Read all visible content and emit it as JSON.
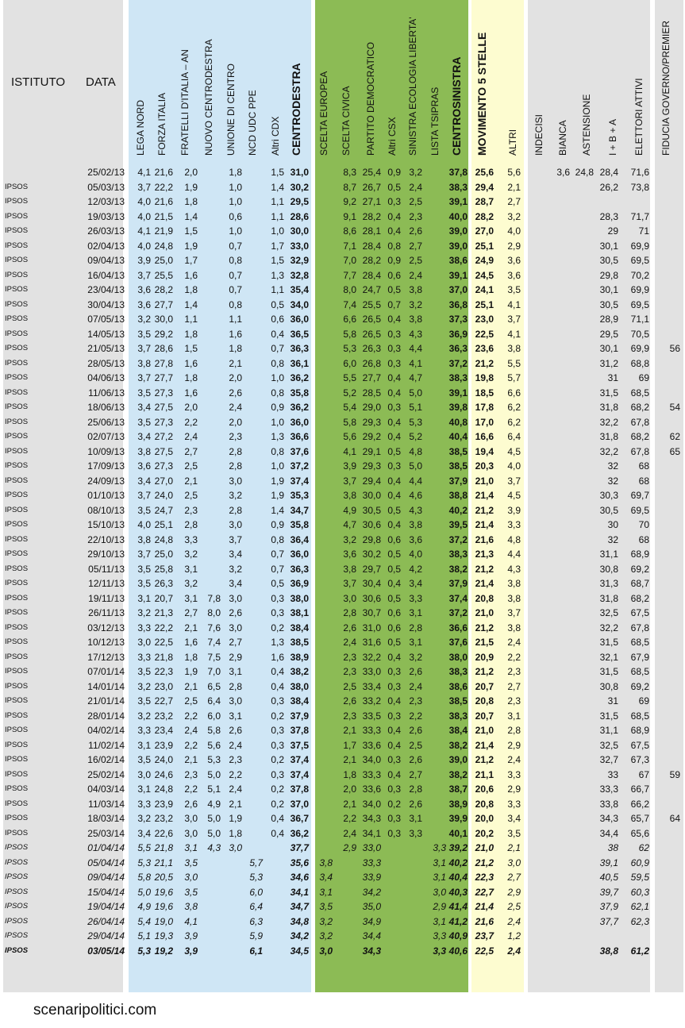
{
  "colors": {
    "grey": "#e2e2e2",
    "blue": "#cfe6f5",
    "green": "#8cbb55",
    "yellow": "#fdfcd0"
  },
  "headers": {
    "istituto": "ISTITUTO",
    "data": "DATA",
    "cols": [
      "LEGA NORD",
      "FORZA ITALIA",
      "FRATELLI D'ITALIA – AN",
      "NUOVO CENTRODESTRA",
      "UNIONE DI CENTRO",
      "NCD UDC PPE",
      "Altri CDX",
      "CENTRODESTRA",
      "SCELTA EUROPEA",
      "SCELTA CIVICA",
      "PARTITO DEMOCRATICO",
      "Altri CSX",
      "SINISTRA ECOLOGIA LIBERTA'",
      "LISTA TSIPRAS",
      "CENTROSINISTRA",
      "MOVIMENTO 5 STELLE",
      "ALTRI",
      "INDECISI",
      "BIANCA",
      "ASTENSIONE",
      "I + B + A",
      "ELETTORI ATTIVI",
      "FIDUCIA GOVERNO/PREMIER"
    ]
  },
  "rows": [
    [
      "",
      "25/02/13",
      "4,1",
      "21,6",
      "2,0",
      "",
      "1,8",
      "",
      "1,5",
      "31,0",
      "",
      "8,3",
      "25,4",
      "0,9",
      "3,2",
      "",
      "37,8",
      "25,6",
      "5,6",
      "",
      "3,6",
      "24,8",
      "28,4",
      "71,6",
      ""
    ],
    [
      "IPSOS",
      "05/03/13",
      "3,7",
      "22,2",
      "1,9",
      "",
      "1,0",
      "",
      "1,4",
      "30,2",
      "",
      "8,7",
      "26,7",
      "0,5",
      "2,4",
      "",
      "38,3",
      "29,4",
      "2,1",
      "",
      "",
      "",
      "26,2",
      "73,8",
      ""
    ],
    [
      "IPSOS",
      "12/03/13",
      "4,0",
      "21,6",
      "1,8",
      "",
      "1,0",
      "",
      "1,1",
      "29,5",
      "",
      "9,2",
      "27,1",
      "0,3",
      "2,5",
      "",
      "39,1",
      "28,7",
      "2,7",
      "",
      "",
      "",
      "",
      "",
      ""
    ],
    [
      "IPSOS",
      "19/03/13",
      "4,0",
      "21,5",
      "1,4",
      "",
      "0,6",
      "",
      "1,1",
      "28,6",
      "",
      "9,1",
      "28,2",
      "0,4",
      "2,3",
      "",
      "40,0",
      "28,2",
      "3,2",
      "",
      "",
      "",
      "28,3",
      "71,7",
      ""
    ],
    [
      "IPSOS",
      "26/03/13",
      "4,1",
      "21,9",
      "1,5",
      "",
      "1,0",
      "",
      "1,0",
      "30,0",
      "",
      "8,6",
      "28,1",
      "0,4",
      "2,6",
      "",
      "39,0",
      "27,0",
      "4,0",
      "",
      "",
      "",
      "29",
      "71",
      ""
    ],
    [
      "IPSOS",
      "02/04/13",
      "4,0",
      "24,8",
      "1,9",
      "",
      "0,7",
      "",
      "1,7",
      "33,0",
      "",
      "7,1",
      "28,4",
      "0,8",
      "2,7",
      "",
      "39,0",
      "25,1",
      "2,9",
      "",
      "",
      "",
      "30,1",
      "69,9",
      ""
    ],
    [
      "IPSOS",
      "09/04/13",
      "3,9",
      "25,0",
      "1,7",
      "",
      "0,8",
      "",
      "1,5",
      "32,9",
      "",
      "7,0",
      "28,2",
      "0,9",
      "2,5",
      "",
      "38,6",
      "24,9",
      "3,6",
      "",
      "",
      "",
      "30,5",
      "69,5",
      ""
    ],
    [
      "IPSOS",
      "16/04/13",
      "3,7",
      "25,5",
      "1,6",
      "",
      "0,7",
      "",
      "1,3",
      "32,8",
      "",
      "7,7",
      "28,4",
      "0,6",
      "2,4",
      "",
      "39,1",
      "24,5",
      "3,6",
      "",
      "",
      "",
      "29,8",
      "70,2",
      ""
    ],
    [
      "IPSOS",
      "23/04/13",
      "3,6",
      "28,2",
      "1,8",
      "",
      "0,7",
      "",
      "1,1",
      "35,4",
      "",
      "8,0",
      "24,7",
      "0,5",
      "3,8",
      "",
      "37,0",
      "24,1",
      "3,5",
      "",
      "",
      "",
      "30,1",
      "69,9",
      ""
    ],
    [
      "IPSOS",
      "30/04/13",
      "3,6",
      "27,7",
      "1,4",
      "",
      "0,8",
      "",
      "0,5",
      "34,0",
      "",
      "7,4",
      "25,5",
      "0,7",
      "3,2",
      "",
      "36,8",
      "25,1",
      "4,1",
      "",
      "",
      "",
      "30,5",
      "69,5",
      ""
    ],
    [
      "IPSOS",
      "07/05/13",
      "3,2",
      "30,0",
      "1,1",
      "",
      "1,1",
      "",
      "0,6",
      "36,0",
      "",
      "6,6",
      "26,5",
      "0,4",
      "3,8",
      "",
      "37,3",
      "23,0",
      "3,7",
      "",
      "",
      "",
      "28,9",
      "71,1",
      ""
    ],
    [
      "IPSOS",
      "14/05/13",
      "3,5",
      "29,2",
      "1,8",
      "",
      "1,6",
      "",
      "0,4",
      "36,5",
      "",
      "5,8",
      "26,5",
      "0,3",
      "4,3",
      "",
      "36,9",
      "22,5",
      "4,1",
      "",
      "",
      "",
      "29,5",
      "70,5",
      ""
    ],
    [
      "IPSOS",
      "21/05/13",
      "3,7",
      "28,6",
      "1,5",
      "",
      "1,8",
      "",
      "0,7",
      "36,3",
      "",
      "5,3",
      "26,3",
      "0,3",
      "4,4",
      "",
      "36,3",
      "23,6",
      "3,8",
      "",
      "",
      "",
      "30,1",
      "69,9",
      "56"
    ],
    [
      "IPSOS",
      "28/05/13",
      "3,8",
      "27,8",
      "1,6",
      "",
      "2,1",
      "",
      "0,8",
      "36,1",
      "",
      "6,0",
      "26,8",
      "0,3",
      "4,1",
      "",
      "37,2",
      "21,2",
      "5,5",
      "",
      "",
      "",
      "31,2",
      "68,8",
      ""
    ],
    [
      "IPSOS",
      "04/06/13",
      "3,7",
      "27,7",
      "1,8",
      "",
      "2,0",
      "",
      "1,0",
      "36,2",
      "",
      "5,5",
      "27,7",
      "0,4",
      "4,7",
      "",
      "38,3",
      "19,8",
      "5,7",
      "",
      "",
      "",
      "31",
      "69",
      ""
    ],
    [
      "IPSOS",
      "11/06/13",
      "3,5",
      "27,3",
      "1,6",
      "",
      "2,6",
      "",
      "0,8",
      "35,8",
      "",
      "5,2",
      "28,5",
      "0,4",
      "5,0",
      "",
      "39,1",
      "18,5",
      "6,6",
      "",
      "",
      "",
      "31,5",
      "68,5",
      ""
    ],
    [
      "IPSOS",
      "18/06/13",
      "3,4",
      "27,5",
      "2,0",
      "",
      "2,4",
      "",
      "0,9",
      "36,2",
      "",
      "5,4",
      "29,0",
      "0,3",
      "5,1",
      "",
      "39,8",
      "17,8",
      "6,2",
      "",
      "",
      "",
      "31,8",
      "68,2",
      "54"
    ],
    [
      "IPSOS",
      "25/06/13",
      "3,5",
      "27,3",
      "2,2",
      "",
      "2,0",
      "",
      "1,0",
      "36,0",
      "",
      "5,8",
      "29,3",
      "0,4",
      "5,3",
      "",
      "40,8",
      "17,0",
      "6,2",
      "",
      "",
      "",
      "32,2",
      "67,8",
      ""
    ],
    [
      "IPSOS",
      "02/07/13",
      "3,4",
      "27,2",
      "2,4",
      "",
      "2,3",
      "",
      "1,3",
      "36,6",
      "",
      "5,6",
      "29,2",
      "0,4",
      "5,2",
      "",
      "40,4",
      "16,6",
      "6,4",
      "",
      "",
      "",
      "31,8",
      "68,2",
      "62"
    ],
    [
      "IPSOS",
      "10/09/13",
      "3,8",
      "27,5",
      "2,7",
      "",
      "2,8",
      "",
      "0,8",
      "37,6",
      "",
      "4,1",
      "29,1",
      "0,5",
      "4,8",
      "",
      "38,5",
      "19,4",
      "4,5",
      "",
      "",
      "",
      "32,2",
      "67,8",
      "65"
    ],
    [
      "IPSOS",
      "17/09/13",
      "3,6",
      "27,3",
      "2,5",
      "",
      "2,8",
      "",
      "1,0",
      "37,2",
      "",
      "3,9",
      "29,3",
      "0,3",
      "5,0",
      "",
      "38,5",
      "20,3",
      "4,0",
      "",
      "",
      "",
      "32",
      "68",
      ""
    ],
    [
      "IPSOS",
      "24/09/13",
      "3,4",
      "27,0",
      "2,1",
      "",
      "3,0",
      "",
      "1,9",
      "37,4",
      "",
      "3,7",
      "29,4",
      "0,4",
      "4,4",
      "",
      "37,9",
      "21,0",
      "3,7",
      "",
      "",
      "",
      "32",
      "68",
      ""
    ],
    [
      "IPSOS",
      "01/10/13",
      "3,7",
      "24,0",
      "2,5",
      "",
      "3,2",
      "",
      "1,9",
      "35,3",
      "",
      "3,8",
      "30,0",
      "0,4",
      "4,6",
      "",
      "38,8",
      "21,4",
      "4,5",
      "",
      "",
      "",
      "30,3",
      "69,7",
      ""
    ],
    [
      "IPSOS",
      "08/10/13",
      "3,5",
      "24,7",
      "2,3",
      "",
      "2,8",
      "",
      "1,4",
      "34,7",
      "",
      "4,9",
      "30,5",
      "0,5",
      "4,3",
      "",
      "40,2",
      "21,2",
      "3,9",
      "",
      "",
      "",
      "30,5",
      "69,5",
      ""
    ],
    [
      "IPSOS",
      "15/10/13",
      "4,0",
      "25,1",
      "2,8",
      "",
      "3,0",
      "",
      "0,9",
      "35,8",
      "",
      "4,7",
      "30,6",
      "0,4",
      "3,8",
      "",
      "39,5",
      "21,4",
      "3,3",
      "",
      "",
      "",
      "30",
      "70",
      ""
    ],
    [
      "IPSOS",
      "22/10/13",
      "3,8",
      "24,8",
      "3,3",
      "",
      "3,7",
      "",
      "0,8",
      "36,4",
      "",
      "3,2",
      "29,8",
      "0,6",
      "3,6",
      "",
      "37,2",
      "21,6",
      "4,8",
      "",
      "",
      "",
      "32",
      "68",
      ""
    ],
    [
      "IPSOS",
      "29/10/13",
      "3,7",
      "25,0",
      "3,2",
      "",
      "3,4",
      "",
      "0,7",
      "36,0",
      "",
      "3,6",
      "30,2",
      "0,5",
      "4,0",
      "",
      "38,3",
      "21,3",
      "4,4",
      "",
      "",
      "",
      "31,1",
      "68,9",
      ""
    ],
    [
      "IPSOS",
      "05/11/13",
      "3,5",
      "25,8",
      "3,1",
      "",
      "3,2",
      "",
      "0,7",
      "36,3",
      "",
      "3,8",
      "29,7",
      "0,5",
      "4,2",
      "",
      "38,2",
      "21,2",
      "4,3",
      "",
      "",
      "",
      "30,8",
      "69,2",
      ""
    ],
    [
      "IPSOS",
      "12/11/13",
      "3,5",
      "26,3",
      "3,2",
      "",
      "3,4",
      "",
      "0,5",
      "36,9",
      "",
      "3,7",
      "30,4",
      "0,4",
      "3,4",
      "",
      "37,9",
      "21,4",
      "3,8",
      "",
      "",
      "",
      "31,3",
      "68,7",
      ""
    ],
    [
      "IPSOS",
      "19/11/13",
      "3,1",
      "20,7",
      "3,1",
      "7,8",
      "3,0",
      "",
      "0,3",
      "38,0",
      "",
      "3,0",
      "30,6",
      "0,5",
      "3,3",
      "",
      "37,4",
      "20,8",
      "3,8",
      "",
      "",
      "",
      "31,8",
      "68,2",
      ""
    ],
    [
      "IPSOS",
      "26/11/13",
      "3,2",
      "21,3",
      "2,7",
      "8,0",
      "2,6",
      "",
      "0,3",
      "38,1",
      "",
      "2,8",
      "30,7",
      "0,6",
      "3,1",
      "",
      "37,2",
      "21,0",
      "3,7",
      "",
      "",
      "",
      "32,5",
      "67,5",
      ""
    ],
    [
      "IPSOS",
      "03/12/13",
      "3,3",
      "22,2",
      "2,1",
      "7,6",
      "3,0",
      "",
      "0,2",
      "38,4",
      "",
      "2,6",
      "31,0",
      "0,6",
      "2,8",
      "",
      "36,6",
      "21,2",
      "3,8",
      "",
      "",
      "",
      "32,2",
      "67,8",
      ""
    ],
    [
      "IPSOS",
      "10/12/13",
      "3,0",
      "22,5",
      "1,6",
      "7,4",
      "2,7",
      "",
      "1,3",
      "38,5",
      "",
      "2,4",
      "31,6",
      "0,5",
      "3,1",
      "",
      "37,6",
      "21,5",
      "2,4",
      "",
      "",
      "",
      "31,5",
      "68,5",
      ""
    ],
    [
      "IPSOS",
      "17/12/13",
      "3,3",
      "21,8",
      "1,8",
      "7,5",
      "2,9",
      "",
      "1,6",
      "38,9",
      "",
      "2,3",
      "32,2",
      "0,4",
      "3,2",
      "",
      "38,0",
      "20,9",
      "2,2",
      "",
      "",
      "",
      "32,1",
      "67,9",
      ""
    ],
    [
      "IPSOS",
      "07/01/14",
      "3,5",
      "22,3",
      "1,9",
      "7,0",
      "3,1",
      "",
      "0,4",
      "38,2",
      "",
      "2,3",
      "33,0",
      "0,3",
      "2,6",
      "",
      "38,3",
      "21,2",
      "2,3",
      "",
      "",
      "",
      "31,5",
      "68,5",
      ""
    ],
    [
      "IPSOS",
      "14/01/14",
      "3,2",
      "23,0",
      "2,1",
      "6,5",
      "2,8",
      "",
      "0,4",
      "38,0",
      "",
      "2,5",
      "33,4",
      "0,3",
      "2,4",
      "",
      "38,6",
      "20,7",
      "2,7",
      "",
      "",
      "",
      "30,8",
      "69,2",
      ""
    ],
    [
      "IPSOS",
      "21/01/14",
      "3,5",
      "22,7",
      "2,5",
      "6,4",
      "3,0",
      "",
      "0,3",
      "38,4",
      "",
      "2,6",
      "33,2",
      "0,4",
      "2,3",
      "",
      "38,5",
      "20,8",
      "2,3",
      "",
      "",
      "",
      "31",
      "69",
      ""
    ],
    [
      "IPSOS",
      "28/01/14",
      "3,2",
      "23,2",
      "2,2",
      "6,0",
      "3,1",
      "",
      "0,2",
      "37,9",
      "",
      "2,3",
      "33,5",
      "0,3",
      "2,2",
      "",
      "38,3",
      "20,7",
      "3,1",
      "",
      "",
      "",
      "31,5",
      "68,5",
      ""
    ],
    [
      "IPSOS",
      "04/02/14",
      "3,3",
      "23,4",
      "2,4",
      "5,8",
      "2,6",
      "",
      "0,3",
      "37,8",
      "",
      "2,1",
      "33,3",
      "0,4",
      "2,6",
      "",
      "38,4",
      "21,0",
      "2,8",
      "",
      "",
      "",
      "31,1",
      "68,9",
      ""
    ],
    [
      "IPSOS",
      "11/02/14",
      "3,1",
      "23,9",
      "2,2",
      "5,6",
      "2,4",
      "",
      "0,3",
      "37,5",
      "",
      "1,7",
      "33,6",
      "0,4",
      "2,5",
      "",
      "38,2",
      "21,4",
      "2,9",
      "",
      "",
      "",
      "32,5",
      "67,5",
      ""
    ],
    [
      "IPSOS",
      "16/02/14",
      "3,5",
      "24,0",
      "2,1",
      "5,3",
      "2,3",
      "",
      "0,2",
      "37,4",
      "",
      "2,1",
      "34,0",
      "0,3",
      "2,6",
      "",
      "39,0",
      "21,2",
      "2,4",
      "",
      "",
      "",
      "32,7",
      "67,3",
      ""
    ],
    [
      "IPSOS",
      "25/02/14",
      "3,0",
      "24,6",
      "2,3",
      "5,0",
      "2,2",
      "",
      "0,3",
      "37,4",
      "",
      "1,8",
      "33,3",
      "0,4",
      "2,7",
      "",
      "38,2",
      "21,1",
      "3,3",
      "",
      "",
      "",
      "33",
      "67",
      "59"
    ],
    [
      "IPSOS",
      "04/03/14",
      "3,1",
      "24,8",
      "2,2",
      "5,1",
      "2,4",
      "",
      "0,2",
      "37,8",
      "",
      "2,0",
      "33,6",
      "0,3",
      "2,8",
      "",
      "38,7",
      "20,6",
      "2,9",
      "",
      "",
      "",
      "33,3",
      "66,7",
      ""
    ],
    [
      "IPSOS",
      "11/03/14",
      "3,3",
      "23,9",
      "2,6",
      "4,9",
      "2,1",
      "",
      "0,2",
      "37,0",
      "",
      "2,1",
      "34,0",
      "0,2",
      "2,6",
      "",
      "38,9",
      "20,8",
      "3,3",
      "",
      "",
      "",
      "33,8",
      "66,2",
      ""
    ],
    [
      "IPSOS",
      "18/03/14",
      "3,2",
      "23,2",
      "3,0",
      "5,0",
      "1,9",
      "",
      "0,4",
      "36,7",
      "",
      "2,2",
      "34,3",
      "0,3",
      "3,1",
      "",
      "39,9",
      "20,0",
      "3,4",
      "",
      "",
      "",
      "34,3",
      "65,7",
      "64"
    ],
    [
      "IPSOS",
      "25/03/14",
      "3,4",
      "22,6",
      "3,0",
      "5,0",
      "1,8",
      "",
      "0,4",
      "36,2",
      "",
      "2,4",
      "34,1",
      "0,3",
      "3,3",
      "",
      "40,1",
      "20,2",
      "3,5",
      "",
      "",
      "",
      "34,4",
      "65,6",
      ""
    ],
    [
      "IPSOS",
      "01/04/14",
      "5,5",
      "21,8",
      "3,1",
      "4,3",
      "3,0",
      "",
      "",
      "37,7",
      "",
      "2,9",
      "33,0",
      "",
      "",
      "3,3",
      "39,2",
      "21,0",
      "2,1",
      "",
      "",
      "",
      "38",
      "62",
      ""
    ],
    [
      "IPSOS",
      "05/04/14",
      "5,3",
      "21,1",
      "3,5",
      "",
      "",
      "5,7",
      "",
      "35,6",
      "3,8",
      "",
      "33,3",
      "",
      "",
      "3,1",
      "40,2",
      "21,2",
      "3,0",
      "",
      "",
      "",
      "39,1",
      "60,9",
      ""
    ],
    [
      "IPSOS",
      "09/04/14",
      "5,8",
      "20,5",
      "3,0",
      "",
      "",
      "5,3",
      "",
      "34,6",
      "3,4",
      "",
      "33,9",
      "",
      "",
      "3,1",
      "40,4",
      "22,3",
      "2,7",
      "",
      "",
      "",
      "40,5",
      "59,5",
      ""
    ],
    [
      "IPSOS",
      "15/04/14",
      "5,0",
      "19,6",
      "3,5",
      "",
      "",
      "6,0",
      "",
      "34,1",
      "3,1",
      "",
      "34,2",
      "",
      "",
      "3,0",
      "40,3",
      "22,7",
      "2,9",
      "",
      "",
      "",
      "39,7",
      "60,3",
      ""
    ],
    [
      "IPSOS",
      "19/04/14",
      "4,9",
      "19,6",
      "3,8",
      "",
      "",
      "6,4",
      "",
      "34,7",
      "3,5",
      "",
      "35,0",
      "",
      "",
      "2,9",
      "41,4",
      "21,4",
      "2,5",
      "",
      "",
      "",
      "37,9",
      "62,1",
      ""
    ],
    [
      "IPSOS",
      "26/04/14",
      "5,4",
      "19,0",
      "4,1",
      "",
      "",
      "6,3",
      "",
      "34,8",
      "3,2",
      "",
      "34,9",
      "",
      "",
      "3,1",
      "41,2",
      "21,6",
      "2,4",
      "",
      "",
      "",
      "37,7",
      "62,3",
      ""
    ],
    [
      "IPSOS",
      "29/04/14",
      "5,1",
      "19,3",
      "3,9",
      "",
      "",
      "5,9",
      "",
      "34,2",
      "3,2",
      "",
      "34,4",
      "",
      "",
      "3,3",
      "40,9",
      "23,7",
      "1,2",
      "",
      "",
      "",
      "",
      "",
      ""
    ],
    [
      "IPSOS",
      "03/05/14",
      "5,3",
      "19,2",
      "3,9",
      "",
      "",
      "6,1",
      "",
      "34,5",
      "3,0",
      "",
      "34,3",
      "",
      "",
      "3,3",
      "40,6",
      "22,5",
      "2,4",
      "",
      "",
      "",
      "38,8",
      "61,2",
      ""
    ]
  ],
  "footer": "scenaripolitici.com"
}
